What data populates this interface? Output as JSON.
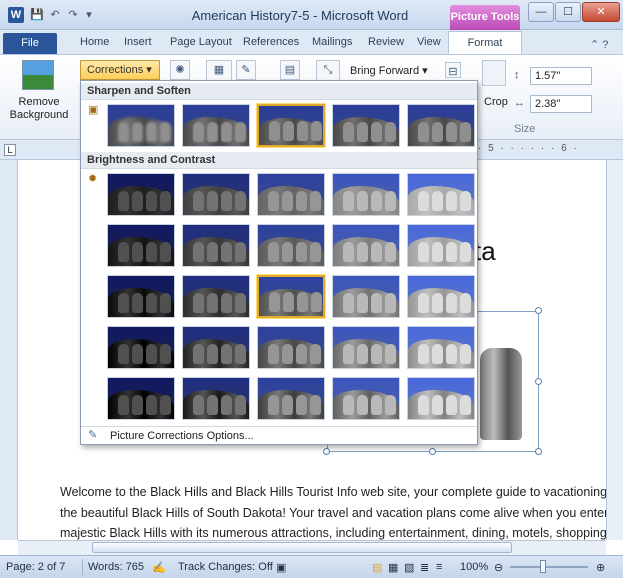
{
  "window": {
    "title": "American History7-5 - Microsoft Word",
    "context_tab": "Picture Tools",
    "min": "—",
    "max": "☐",
    "close": "✕"
  },
  "qat": {
    "save": "💾",
    "undo": "↶",
    "redo": "↷",
    "more": "▾"
  },
  "ribbon_tabs": [
    "File",
    "Home",
    "Insert",
    "Page Layout",
    "References",
    "Mailings",
    "Review",
    "View",
    "Format"
  ],
  "ribbon": {
    "remove_background": "Remove\nBackground",
    "corrections": "Corrections ▾",
    "bring_forward": "Bring Forward ▾",
    "crop": "Crop",
    "height": "1.57\"",
    "width": "2.38\"",
    "size_group": "Size"
  },
  "ruler_marks": "· 5 · · · · · · 6 ·",
  "gallery": {
    "section_sharpen": "Sharpen and Soften",
    "section_brightness": "Brightness and Contrast",
    "options": "Picture Corrections Options...",
    "sharpen_selected_index": 2,
    "brightness_selected": {
      "row": 2,
      "col": 2
    }
  },
  "document": {
    "heading_fragment": "ta",
    "paragraph": [
      "Welcome to the Black Hills and Black Hills Tourist Info web site, your complete guide to vacationing in",
      "the beautiful Black Hills of South Dakota! Your travel and vacation plans come alive when you enter t",
      "majestic Black Hills with its numerous attractions, including entertainment, dining, motels, shopping,"
    ]
  },
  "status": {
    "page": "Page: 2 of 7",
    "words": "Words: 765",
    "track_changes": "Track Changes: Off",
    "zoom": "100%"
  },
  "colors": {
    "accent": "#2a5699",
    "picture_tools": "#b94ab4",
    "selection": "#e2a92b"
  }
}
